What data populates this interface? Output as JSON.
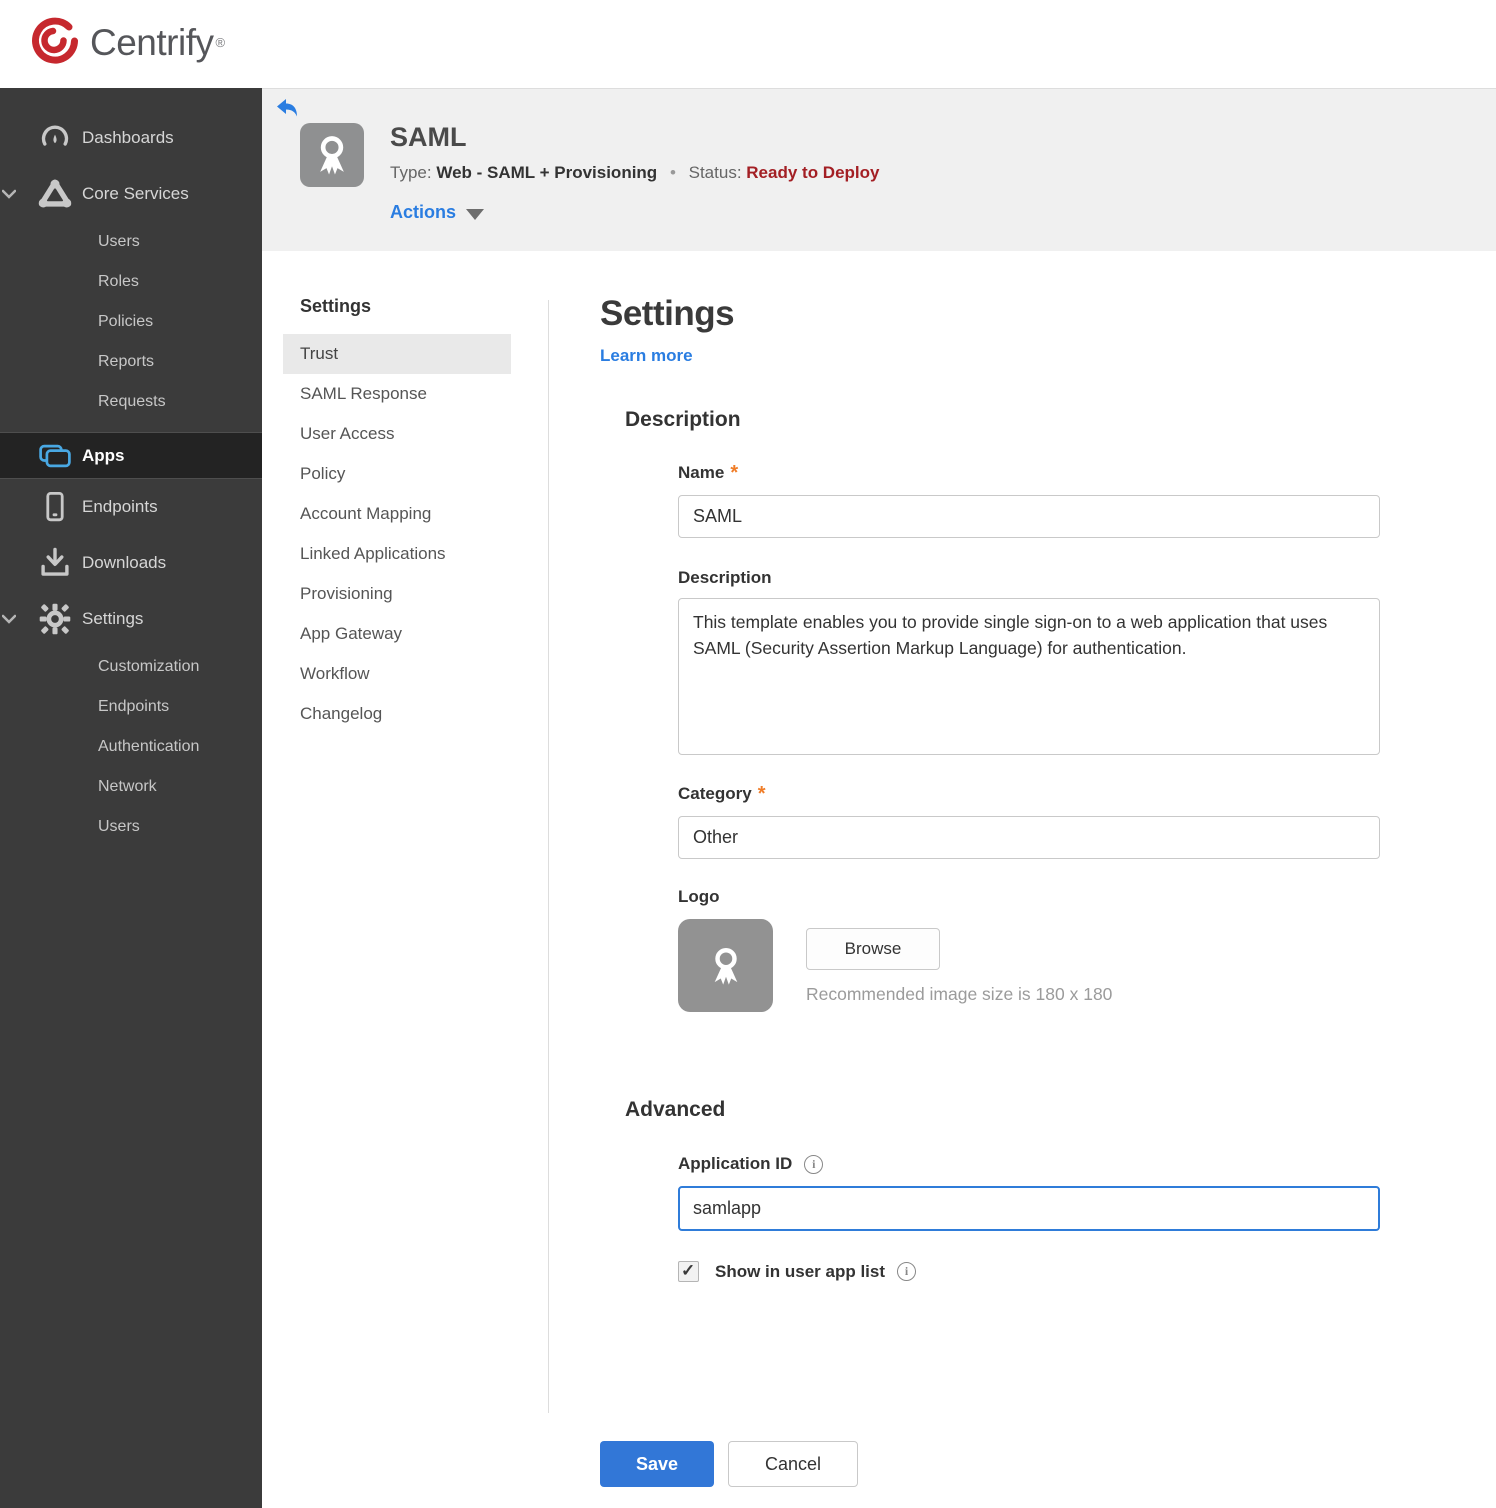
{
  "brand": {
    "name": "Centrify",
    "mark": "®"
  },
  "colors": {
    "accent_blue": "#2a7de1",
    "save_blue": "#3277d7",
    "status_red": "#a31f24",
    "asterisk_orange": "#f07d28",
    "sidebar_bg": "#3b3b3b",
    "sidebar_active_bg": "#232323",
    "apps_icon_blue": "#49a8e3",
    "header_bg": "#f0f0f0"
  },
  "sidebar": {
    "items": [
      {
        "label": "Dashboards",
        "level": "top",
        "icon": "gauge-icon"
      },
      {
        "label": "Core Services",
        "level": "top",
        "icon": "core-services-icon",
        "expanded": true
      },
      {
        "label": "Users",
        "level": "sub"
      },
      {
        "label": "Roles",
        "level": "sub"
      },
      {
        "label": "Policies",
        "level": "sub"
      },
      {
        "label": "Reports",
        "level": "sub"
      },
      {
        "label": "Requests",
        "level": "sub"
      },
      {
        "label": "Apps",
        "level": "top",
        "icon": "apps-icon",
        "active": true
      },
      {
        "label": "Endpoints",
        "level": "top",
        "icon": "endpoint-icon"
      },
      {
        "label": "Downloads",
        "level": "top",
        "icon": "download-icon"
      },
      {
        "label": "Settings",
        "level": "top",
        "icon": "gear-icon",
        "expanded": true
      },
      {
        "label": "Customization",
        "level": "sub"
      },
      {
        "label": "Endpoints",
        "level": "sub"
      },
      {
        "label": "Authentication",
        "level": "sub"
      },
      {
        "label": "Network",
        "level": "sub"
      },
      {
        "label": "Users",
        "level": "sub"
      }
    ]
  },
  "app_header": {
    "title": "SAML",
    "type_label": "Type:",
    "type_value": "Web - SAML + Provisioning",
    "separator": "•",
    "status_label": "Status:",
    "status_value": "Ready to Deploy",
    "actions_label": "Actions"
  },
  "subnav": {
    "header": "Settings",
    "items": [
      {
        "label": "Trust",
        "active": true
      },
      {
        "label": "SAML Response"
      },
      {
        "label": "User Access"
      },
      {
        "label": "Policy"
      },
      {
        "label": "Account Mapping"
      },
      {
        "label": "Linked Applications"
      },
      {
        "label": "Provisioning"
      },
      {
        "label": "App Gateway"
      },
      {
        "label": "Workflow"
      },
      {
        "label": "Changelog"
      }
    ]
  },
  "main": {
    "title": "Settings",
    "learn_more": "Learn more",
    "required_marker": "*",
    "description_section": {
      "heading": "Description",
      "name_label": "Name",
      "name_value": "SAML",
      "description_label": "Description",
      "description_value": "This template enables you to provide single sign-on to a web application that uses SAML (Security Assertion Markup Language) for authentication.",
      "category_label": "Category",
      "category_value": "Other",
      "logo_label": "Logo",
      "browse_label": "Browse",
      "logo_hint": "Recommended image size is 180 x 180"
    },
    "advanced_section": {
      "heading": "Advanced",
      "application_id_label": "Application ID",
      "application_id_value": "samlapp",
      "show_in_app_list_label": "Show in user app list",
      "show_in_app_list_checked": true
    },
    "footer": {
      "save_label": "Save",
      "cancel_label": "Cancel"
    }
  }
}
